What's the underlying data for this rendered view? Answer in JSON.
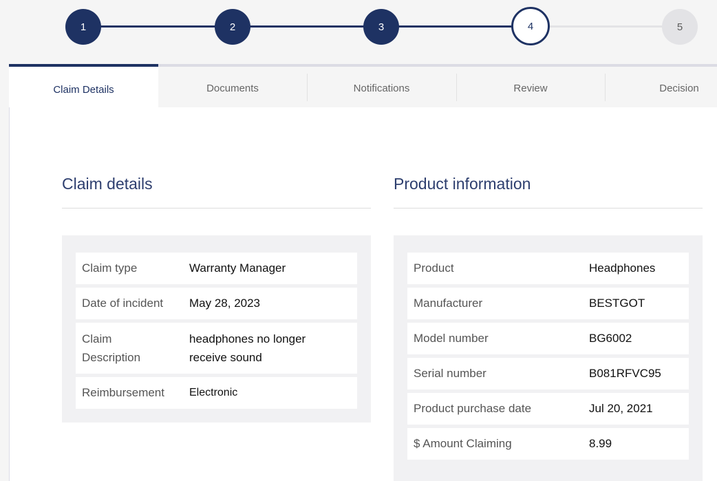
{
  "stepper": {
    "steps": [
      {
        "label": "1",
        "state": "done"
      },
      {
        "label": "2",
        "state": "done"
      },
      {
        "label": "3",
        "state": "done"
      },
      {
        "label": "4",
        "state": "current"
      },
      {
        "label": "5",
        "state": "todo"
      }
    ],
    "colors": {
      "done": "#1e3263",
      "todo": "#e3e3e6"
    }
  },
  "tabs": [
    {
      "label": "Claim Details",
      "active": true
    },
    {
      "label": "Documents",
      "active": false
    },
    {
      "label": "Notifications",
      "active": false
    },
    {
      "label": "Review",
      "active": false
    },
    {
      "label": "Decision",
      "active": false
    }
  ],
  "claim_details": {
    "title": "Claim details",
    "rows": [
      {
        "key": "Claim type",
        "value": "Warranty Manager"
      },
      {
        "key": "Date of incident",
        "value": "May 28, 2023"
      },
      {
        "key_line1": "Claim",
        "key_line2": "Description",
        "value_line1": "headphones no longer",
        "value_line2": "receive sound"
      },
      {
        "key": "Reimbursement",
        "value": "Electronic"
      }
    ]
  },
  "product_info": {
    "title": "Product information",
    "rows": [
      {
        "key": "Product",
        "value": "Headphones"
      },
      {
        "key": "Manufacturer",
        "value": "BESTGOT"
      },
      {
        "key": "Model number",
        "value": "BG6002"
      },
      {
        "key": "Serial number",
        "value": "B081RFVC95"
      },
      {
        "key": "Product purchase date",
        "value": "Jul 20, 2021"
      },
      {
        "key": "$ Amount Claiming",
        "value": "8.99"
      }
    ]
  }
}
